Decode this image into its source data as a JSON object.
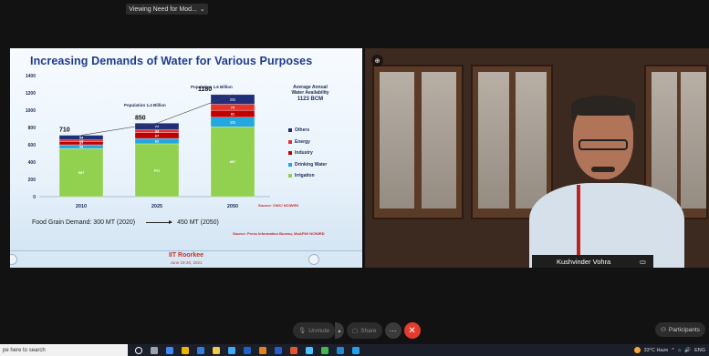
{
  "share_banner": {
    "label": "Viewing Need for Mod...",
    "chevron": "chevron-down-icon"
  },
  "slide": {
    "title": "Increasing Demands of Water for Various Purposes",
    "availability": {
      "line1": "Average Annual",
      "line2": "Water Availability",
      "value": "1123 BCM"
    },
    "population_labels": [
      "Population 1.4 Billion",
      "Population 1.6 Billion"
    ],
    "source_cwc": "Source: CWC/ NCIWRD",
    "food_left": "Food Grain Demand: 300 MT (2020)",
    "food_right": "450 MT (2050)",
    "source_pib": "Source: Press Information Bureau, MoAFW/ NCIWRD",
    "footer_title": "IIT Roorkee",
    "footer_date": "June 18-20, 2021"
  },
  "chart_data": {
    "type": "bar",
    "stacked": true,
    "categories": [
      "2010",
      "2025",
      "2050"
    ],
    "ylim": [
      0,
      1400
    ],
    "yticks": [
      0,
      200,
      400,
      600,
      800,
      1000,
      1200,
      1400
    ],
    "totals": [
      710,
      850,
      1180
    ],
    "series": [
      {
        "name": "Irrigation",
        "color": "#92d050",
        "values": [
          557,
          611,
          807
        ]
      },
      {
        "name": "Drinking Water",
        "color": "#22a7e0",
        "values": [
          43,
          62,
          111
        ]
      },
      {
        "name": "Industry",
        "color": "#c00000",
        "values": [
          37,
          67,
          81
        ]
      },
      {
        "name": "Energy",
        "color": "#e8322c",
        "values": [
          19,
          33,
          70
        ]
      },
      {
        "name": "Others",
        "color": "#1f2f7a",
        "values": [
          54,
          77,
          111
        ]
      }
    ],
    "legend_order": [
      "Others",
      "Energy",
      "Industry",
      "Drinking Water",
      "Irrigation"
    ]
  },
  "video": {
    "participant_name": "Kushvinder Vohra",
    "pin_icon": "pin-icon",
    "name_tag_icon": "camera-icon"
  },
  "controls": {
    "unmute": "Unmute",
    "share": "Share",
    "more_icon": "more-icon",
    "end_icon": "close-icon",
    "participants": "Participants"
  },
  "taskbar": {
    "search_placeholder": "pe here to search",
    "weather": "33°C Haze",
    "lang": "ENG",
    "icon_colors": [
      "#ffffff",
      "#9aa4b5",
      "#3d8af7",
      "#f0b400",
      "#2f7ee0",
      "#f2c94c",
      "#3fa9f5",
      "#1e64c8",
      "#e67e22",
      "#2a5bd7",
      "#e4572e",
      "#4cc2ff",
      "#3fb950",
      "#1f8bd6",
      "#24a0ed"
    ]
  }
}
